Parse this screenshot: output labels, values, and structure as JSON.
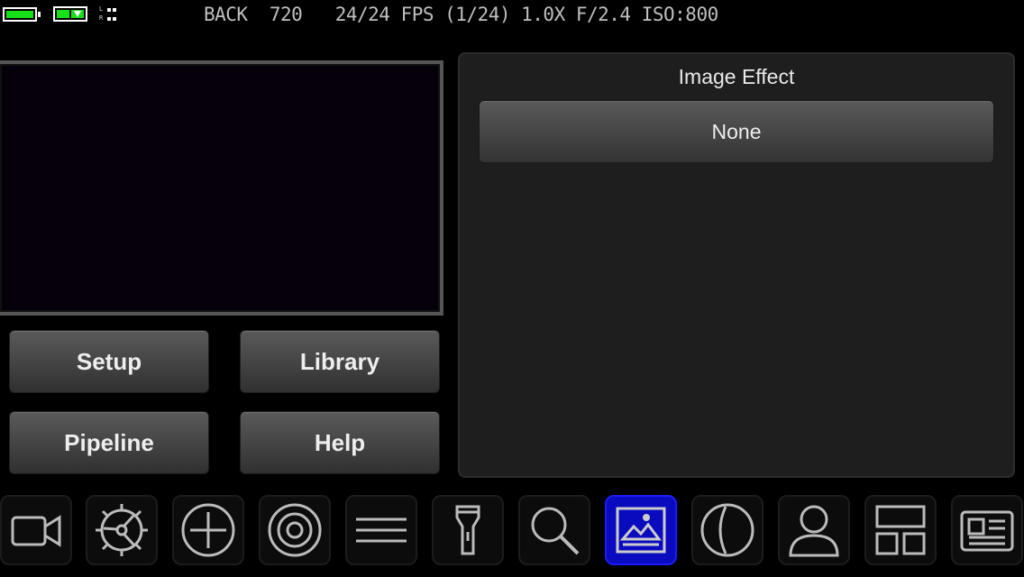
{
  "status": {
    "battery_icon": "battery-full-icon",
    "storage_icon": "storage-icon",
    "audio_meter_icon": "audio-meter-icon",
    "audio_left": "L",
    "audio_right": "R",
    "text": "BACK  720   24/24 FPS (1/24) 1.0X F/2.4 ISO:800",
    "battery_color": "#18e018"
  },
  "buttons": {
    "setup": "Setup",
    "library": "Library",
    "pipeline": "Pipeline",
    "help": "Help"
  },
  "panel": {
    "title": "Image Effect",
    "selected_effect": "None"
  },
  "toolbar": {
    "active_color": "#0a0abf",
    "items": [
      {
        "icon": "video-camera-icon"
      },
      {
        "icon": "gear-icon"
      },
      {
        "icon": "crosshair-icon"
      },
      {
        "icon": "target-icon"
      },
      {
        "icon": "menu-lines-icon"
      },
      {
        "icon": "flashlight-icon"
      },
      {
        "icon": "magnifier-icon"
      },
      {
        "icon": "image-icon",
        "active": true
      },
      {
        "icon": "contrast-icon"
      },
      {
        "icon": "person-icon"
      },
      {
        "icon": "layout-icon"
      },
      {
        "icon": "article-icon"
      }
    ]
  }
}
